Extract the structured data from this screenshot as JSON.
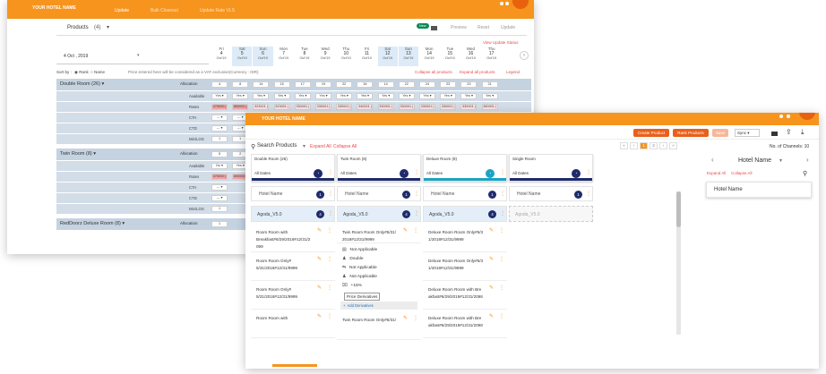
{
  "back_window": {
    "header": {
      "brand": "YOUR HOTEL NAME",
      "nav": [
        "Update",
        "Bulk Closeout",
        "Update Rate VLS"
      ]
    },
    "products_label": "Products",
    "products_count": "(4)",
    "new_badge": "New",
    "actions": [
      "Preview",
      "Reset",
      "Update"
    ],
    "view_update_status": "View Update Status",
    "date_value": "4 Oct , 2019",
    "days": [
      {
        "dow": "Fri",
        "d": "4",
        "m": "Oct'19"
      },
      {
        "dow": "Sat",
        "d": "5",
        "m": "Oct'19"
      },
      {
        "dow": "Sun",
        "d": "6",
        "m": "Oct'19"
      },
      {
        "dow": "Mon",
        "d": "7",
        "m": "Oct'19"
      },
      {
        "dow": "Tue",
        "d": "8",
        "m": "Oct'19"
      },
      {
        "dow": "Wed",
        "d": "9",
        "m": "Oct'19"
      },
      {
        "dow": "Thu",
        "d": "10",
        "m": "Oct'19"
      },
      {
        "dow": "Fri",
        "d": "11",
        "m": "Oct'19"
      },
      {
        "dow": "Sat",
        "d": "12",
        "m": "Oct'19"
      },
      {
        "dow": "Sun",
        "d": "13",
        "m": "Oct'19"
      },
      {
        "dow": "Mon",
        "d": "14",
        "m": "Oct'19"
      },
      {
        "dow": "Tue",
        "d": "15",
        "m": "Oct'19"
      },
      {
        "dow": "Wed",
        "d": "16",
        "m": "Oct'19"
      },
      {
        "dow": "Thu",
        "d": "17",
        "m": "Oct'19"
      }
    ],
    "sort_label": "Sort by :",
    "sort_rank": "Rank",
    "sort_name": "Name",
    "price_note": "Price entered here will be considered as a VAT exclusive(Currency : IDR)",
    "collapse_all_products": "Collapse all products",
    "expand_all_products": "Expand all products",
    "legend": "Legend",
    "rooms": [
      {
        "name": "Double Room (26) ▾",
        "allocation_label": "Allocation",
        "allocation": [
          "4",
          "8",
          "14",
          "15",
          "17",
          "19",
          "22",
          "16",
          "14",
          "22",
          "24",
          "23",
          "23",
          "21"
        ]
      },
      {
        "name": "Twin Room (8) ▾",
        "allocation_label": "Allocation",
        "allocation": [
          "5",
          "2"
        ]
      },
      {
        "name": "RedDoorz Deluxe Room (8) ▾",
        "allocation_label": "Allocation",
        "allocation": [
          "1"
        ]
      }
    ],
    "row_labels": [
      "Available",
      "Rates",
      "CTA",
      "CTD",
      "Min/LOS"
    ],
    "available_value": "Yes ▾",
    "available_value_no": "No ▾",
    "rate_values": [
      "475000 |",
      "800000 |",
      "323001 |",
      "323001 |",
      "330001 |",
      "330001 |",
      "330001 |",
      "340001 |",
      "330001 |",
      "330001 |",
      "330001 |",
      "330001 |",
      "330001 |",
      "380001 |"
    ],
    "cta_value": "--- ▾",
    "minlos_value": "1"
  },
  "front_window": {
    "header": {
      "brand": "YOUR HOTEL NAME"
    },
    "buttons": {
      "create_product": "Create Product",
      "rank_products": "Rank Products",
      "save": "Save",
      "sync": "Sync"
    },
    "search_label": "Search Products",
    "expand_all": "Expand All",
    "collapse_all": "Collapse All",
    "pagination": [
      "«",
      "‹",
      "1",
      "2",
      "›",
      "»"
    ],
    "channels_label": "No. of Channels: 10",
    "columns": [
      {
        "title": "Double Room (26)",
        "dates": "All Dates",
        "stripe": "#1f2b6b",
        "hotel": "Hotel Name",
        "hotel_count": "1",
        "agoda": "Agoda_V5.0",
        "agoda_count": "4",
        "items": [
          "Room Room with Breakfast#6/29/2019#12/31/2 099",
          "Room Room Only# 5/31/2018#12/31/9999",
          "Room Room Only# 5/31/2018#12/31/9999",
          "Room Room with"
        ]
      },
      {
        "title": "Twin Room (8)",
        "dates": "All Dates",
        "stripe": "#1f2b6b",
        "hotel": "Hotel Name",
        "hotel_count": "1",
        "agoda": "Agoda_V5.0",
        "agoda_count": "4",
        "items": [
          "Twin Room Room Only#5/31/ 2018#12/31/9999",
          "Twin Room Room Only#5/31/"
        ],
        "details": [
          "Not Applicable",
          "Double",
          "Not Applicable",
          "Not Applicable",
          "+15%"
        ],
        "tooltip": "Price Derivatives",
        "add_link": "Add Derivatives"
      },
      {
        "title": "Deluxe Room (8)",
        "dates": "All Dates",
        "stripe": "#1ca3c4",
        "hotel": "Hotel Name",
        "hotel_count": "1",
        "agoda": "Agoda_V5.0",
        "agoda_count": "4",
        "items": [
          "Deluxe Room Room Only#5/3 1/2018#12/31/9999",
          "Deluxe Room Room Only#5/3 1/2018#12/31/9999",
          "Deluxe Room Room with Bre akfast#6/29/2019#12/31/2098",
          "Deluxe Room Room with Bre akfast#6/29/2019#12/31/2098"
        ]
      },
      {
        "title": "Single Room",
        "dates": "All Dates",
        "stripe": "#1f2b6b",
        "hotel": "Hotel Name",
        "hotel_count": "1",
        "agoda": "Agoda_V5.0",
        "agoda_count": ""
      }
    ],
    "side_panel": {
      "title": "Hotel Name",
      "expand_all": "Expand All",
      "collapse_all": "Collapse All",
      "item": "Hotel Name"
    }
  },
  "colors": {
    "accent": "#f7941d",
    "brand_dark": "#1f2b6b",
    "header_blue": "#c5d3e0",
    "danger": "#e94b4b"
  }
}
